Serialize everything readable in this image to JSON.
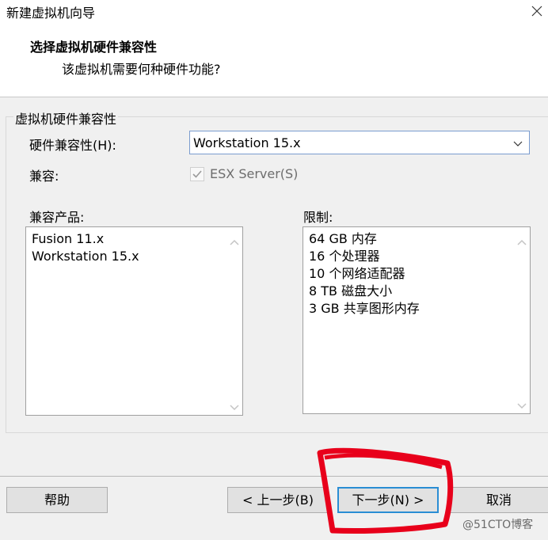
{
  "window": {
    "title": "新建虚拟机向导"
  },
  "header": {
    "title": "选择虚拟机硬件兼容性",
    "subtitle": "该虚拟机需要何种硬件功能?"
  },
  "group": {
    "label": "虚拟机硬件兼容性",
    "hw_label": "硬件兼容性(H):",
    "hw_value": "Workstation 15.x",
    "compat_label": "兼容:",
    "esx_label": "ESX Server(S)",
    "esx_checked": true,
    "esx_disabled": true,
    "products_label": "兼容产品:",
    "products": [
      "Fusion 11.x",
      "Workstation 15.x"
    ],
    "limits_label": "限制:",
    "limits": [
      "64 GB 内存",
      "16 个处理器",
      "10 个网络适配器",
      "8 TB 磁盘大小",
      "3 GB 共享图形内存"
    ]
  },
  "buttons": {
    "help": "帮助",
    "back": "< 上一步(B)",
    "next": "下一步(N) >",
    "cancel": "取消"
  },
  "watermark": "@51CTO博客",
  "colors": {
    "accent": "#2a8dd4",
    "annotation": "#e8001b"
  }
}
